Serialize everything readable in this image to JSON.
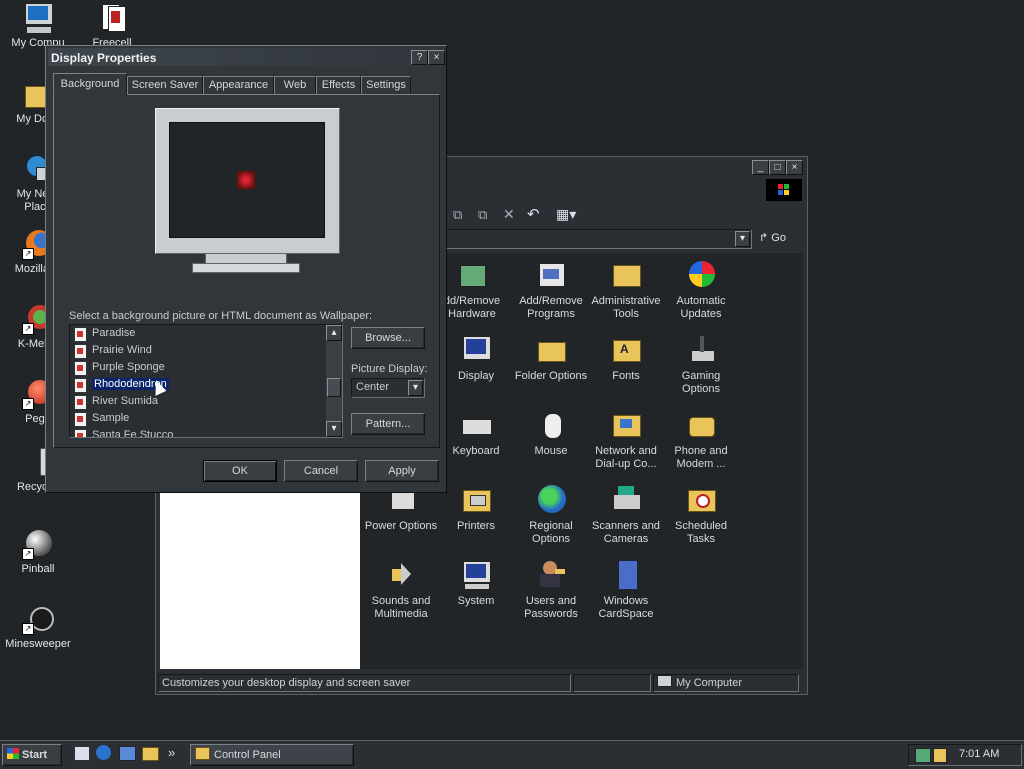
{
  "desktop": {
    "icons": [
      {
        "label": "My Computer",
        "icon": "computer-icon"
      },
      {
        "label": "Freecell",
        "icon": "cards-icon"
      },
      {
        "label": "My Documents",
        "icon": "folder-icon"
      },
      {
        "label": "My Network Places",
        "icon": "network-icon"
      },
      {
        "label": "Mozilla Firefox",
        "icon": "firefox-icon"
      },
      {
        "label": "K-Meleon",
        "icon": "kmeleon-icon"
      },
      {
        "label": "Pegasus",
        "icon": "pegasus-icon"
      },
      {
        "label": "Recycle Bin",
        "icon": "recycle-bin-icon"
      },
      {
        "label": "Pinball",
        "icon": "pinball-icon"
      },
      {
        "label": "Minesweeper",
        "icon": "minesweeper-icon"
      }
    ],
    "visible_labels": {
      "my_computer": "My Compu",
      "freecell": "Freecell",
      "my_documents": "My Docu",
      "network_1": "My Netw",
      "network_2": "Place",
      "firefox": "Mozilla Fi",
      "kmeleon": "K-Melec",
      "pegasus": "Pega",
      "recycle": "Recycle Bin",
      "pinball": "Pinball",
      "minesweeper": "Minesweeper"
    }
  },
  "control_panel": {
    "go_label": "Go",
    "items": [
      {
        "label": "Add/Remove Hardware",
        "icon": "hardware-icon"
      },
      {
        "label": "Add/Remove Programs",
        "icon": "programs-icon"
      },
      {
        "label": "Administrative Tools",
        "icon": "admin-tools-icon"
      },
      {
        "label": "Automatic Updates",
        "icon": "windows-update-icon"
      },
      {
        "label": "Display",
        "icon": "display-icon"
      },
      {
        "label": "Folder Options",
        "icon": "folder-options-icon"
      },
      {
        "label": "Fonts",
        "icon": "fonts-icon"
      },
      {
        "label": "Gaming Options",
        "icon": "joystick-icon"
      },
      {
        "label": "Keyboard",
        "icon": "keyboard-icon"
      },
      {
        "label": "Mouse",
        "icon": "mouse-icon"
      },
      {
        "label": "Network and Dial-up Co...",
        "icon": "network-dialup-icon"
      },
      {
        "label": "Phone and Modem ...",
        "icon": "phone-icon"
      },
      {
        "label": "Power Options",
        "icon": "power-icon"
      },
      {
        "label": "Printers",
        "icon": "printer-icon"
      },
      {
        "label": "Regional Options",
        "icon": "globe-icon"
      },
      {
        "label": "Scanners and Cameras",
        "icon": "scanner-icon"
      },
      {
        "label": "Scheduled Tasks",
        "icon": "scheduled-tasks-icon"
      },
      {
        "label": "Sounds and Multimedia",
        "icon": "speaker-icon"
      },
      {
        "label": "System",
        "icon": "system-icon"
      },
      {
        "label": "Users and Passwords",
        "icon": "users-icon"
      },
      {
        "label": "Windows CardSpace",
        "icon": "cardspace-icon"
      }
    ],
    "item_lines": {
      "hw1": "dd/Remove",
      "hw2": "Hardware",
      "pr1": "Add/Remove",
      "pr2": "Programs",
      "at1": "Administrative",
      "at2": "Tools",
      "au1": "Automatic",
      "au2": "Updates",
      "disp": "Display",
      "fo": "Folder Options",
      "fonts": "Fonts",
      "go1": "Gaming",
      "go2": "Options",
      "kb": "Keyboard",
      "mouse": "Mouse",
      "nd1": "Network and",
      "nd2": "Dial-up Co...",
      "pm1": "Phone and",
      "pm2": "Modem ...",
      "po": "Power Options",
      "printers": "Printers",
      "ro1": "Regional",
      "ro2": "Options",
      "sc1": "Scanners and",
      "sc2": "Cameras",
      "st1": "Scheduled",
      "st2": "Tasks",
      "sm1": "Sounds and",
      "sm2": "Multimedia",
      "system": "System",
      "up1": "Users and",
      "up2": "Passwords",
      "wc1": "Windows",
      "wc2": "CardSpace"
    },
    "status": {
      "description": "Customizes your desktop display and screen saver",
      "location": "My Computer"
    }
  },
  "display_properties": {
    "title": "Display Properties",
    "help_btn": "?",
    "close_btn": "×",
    "tabs": [
      "Background",
      "Screen Saver",
      "Appearance",
      "Web",
      "Effects",
      "Settings"
    ],
    "wallpaper_prompt": "Select a background picture or HTML document as Wallpaper:",
    "wallpapers": [
      "Paradise",
      "Prairie Wind",
      "Purple Sponge",
      "Rhododendron",
      "River Sumida",
      "Sample",
      "Santa Fe Stucco"
    ],
    "selected_wallpaper": "Rhododendron",
    "browse_label": "Browse...",
    "picture_display_label": "Picture Display:",
    "picture_display_value": "Center",
    "pattern_label": "Pattern...",
    "ok_label": "OK",
    "cancel_label": "Cancel",
    "apply_label": "Apply"
  },
  "taskbar": {
    "start_label": "Start",
    "overflow_label": "»",
    "task_label": "Control Panel",
    "clock": "7:01 AM"
  }
}
